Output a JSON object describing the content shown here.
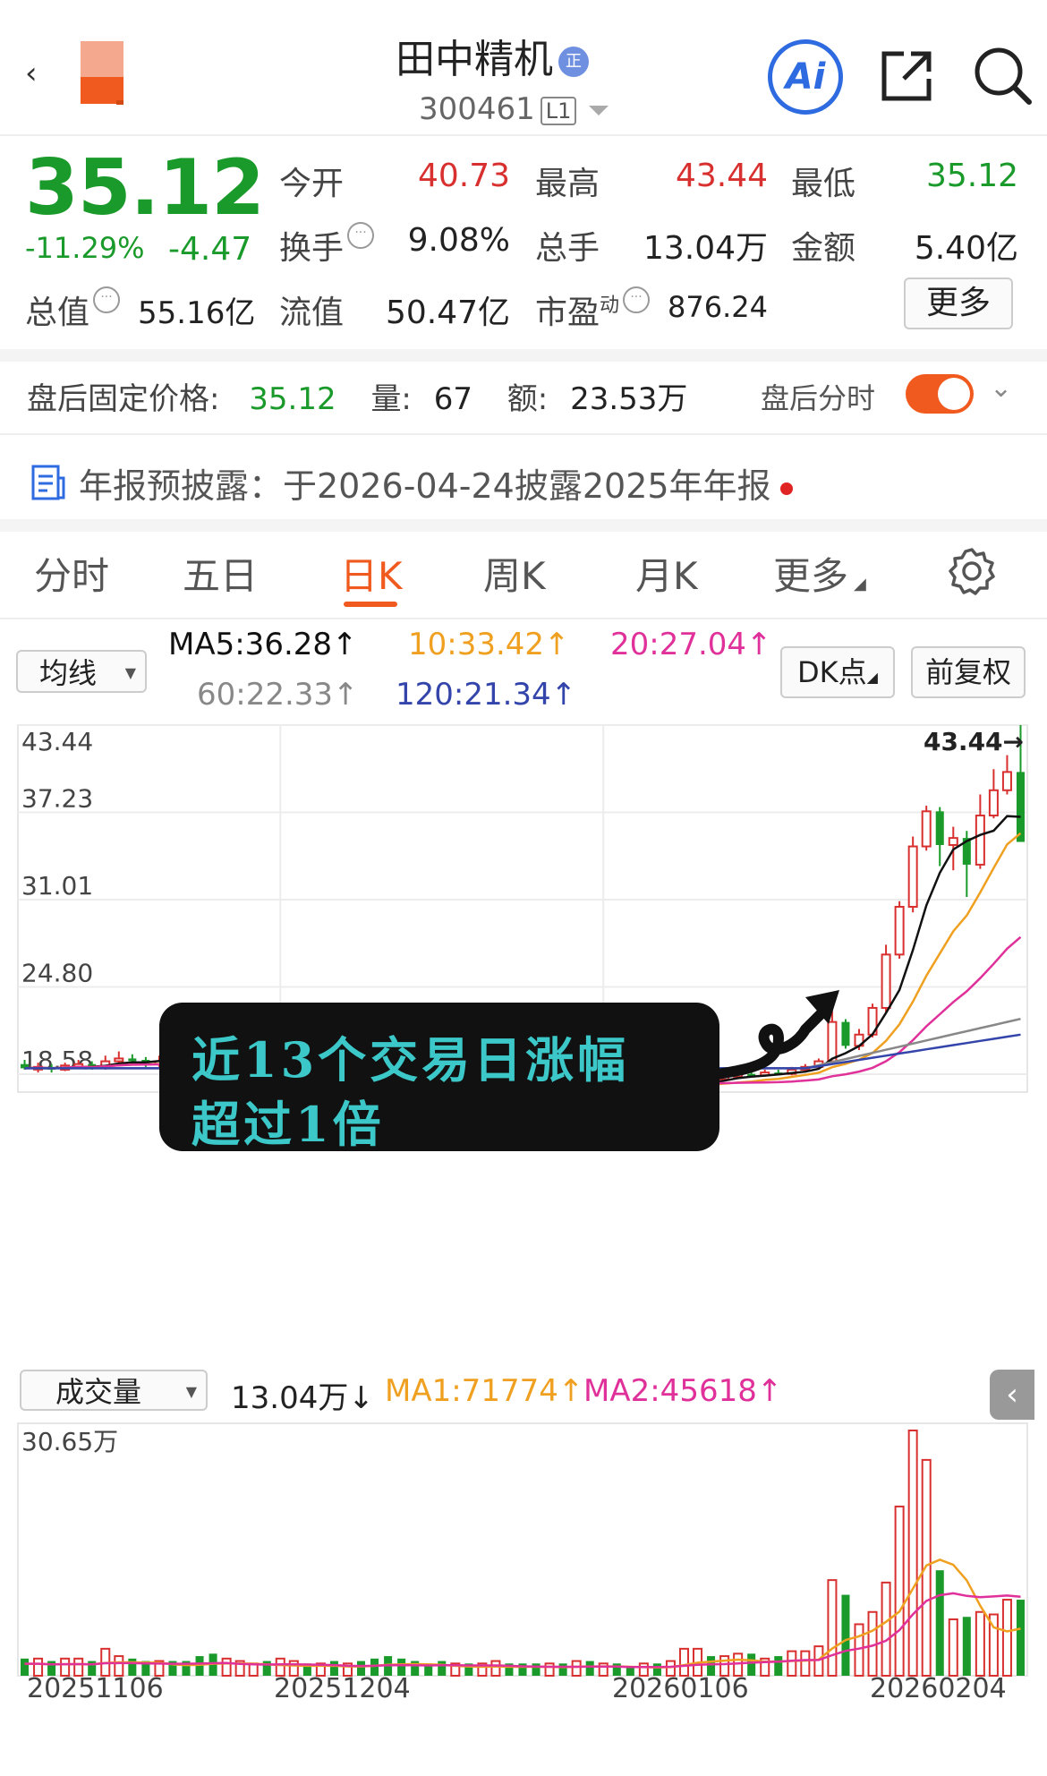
{
  "header": {
    "back": "‹",
    "name": "田中精机",
    "badge": "正",
    "code": "300461",
    "level": "L1",
    "ai_label": "Ai"
  },
  "quote": {
    "price": "35.12",
    "pct": "-11.29%",
    "change": "-4.47",
    "open_label": "今开",
    "open": "40.73",
    "high_label": "最高",
    "high": "43.44",
    "low_label": "最低",
    "low": "35.12",
    "turnover_label": "换手",
    "turnover": "9.08%",
    "volume_label": "总手",
    "volume": "13.04万",
    "amount_label": "金额",
    "amount": "5.40亿",
    "mktcap_label": "总值",
    "mktcap": "55.16亿",
    "float_label": "流值",
    "float": "50.47亿",
    "pe_label": "市盈",
    "pe_sup": "动",
    "pe": "876.24",
    "more": "更多"
  },
  "after_hours": {
    "label": "盘后固定价格:",
    "price": "35.12",
    "vol_label": "量:",
    "vol": "67",
    "amt_label": "额:",
    "amt": "23.53万",
    "toggle_label": "盘后分时"
  },
  "annual": {
    "text": "年报预披露：于2026-04-24披露2025年年报"
  },
  "tabs": [
    "分时",
    "五日",
    "日K",
    "周K",
    "月K",
    "更多"
  ],
  "ma": {
    "selector": "均线",
    "ma5": "MA5:36.28↑",
    "ma10": "10:33.42↑",
    "ma20": "20:27.04↑",
    "ma60": "60:22.33↑",
    "ma120": "120:21.34↑",
    "dk": "DK点",
    "adjust": "前复权"
  },
  "colors": {
    "up": "#d8302f",
    "down": "#1a9a2a",
    "accent": "#f05a1e",
    "ma5": "#111111",
    "ma10": "#f0a020",
    "ma20": "#e0309a",
    "ma60": "#888888",
    "ma120": "#3344aa"
  },
  "volume": {
    "selector": "成交量",
    "value": "13.04万↓",
    "ma1": "MA1:71774↑",
    "ma2": "MA2:45618↑",
    "max_label": "30.65万"
  },
  "annotation": {
    "line1": "近13个交易日涨幅",
    "line2": "超过1倍"
  },
  "chart_data": {
    "type": "candlestick",
    "y_ticks": [
      "43.44",
      "37.23",
      "31.01",
      "24.80",
      "18.58"
    ],
    "ylim": [
      18.58,
      43.44
    ],
    "high_marker": "43.44→",
    "low_marker": "18.58",
    "x_ticks": [
      "20251106",
      "20251204",
      "20260106",
      "20260204"
    ],
    "candles": [
      [
        19.3,
        19.0,
        19.6,
        18.9
      ],
      [
        19.0,
        19.1,
        19.4,
        18.7
      ],
      [
        19.1,
        18.9,
        19.3,
        18.7
      ],
      [
        18.9,
        19.2,
        19.4,
        18.8
      ],
      [
        19.2,
        19.3,
        19.6,
        19.0
      ],
      [
        19.3,
        19.0,
        19.5,
        18.9
      ],
      [
        19.0,
        19.5,
        19.9,
        18.9
      ],
      [
        19.5,
        19.7,
        20.2,
        19.3
      ],
      [
        19.7,
        19.6,
        20.0,
        19.3
      ],
      [
        19.6,
        19.3,
        19.8,
        19.1
      ],
      [
        19.3,
        19.5,
        19.9,
        19.1
      ],
      [
        19.5,
        19.4,
        19.7,
        19.1
      ],
      [
        19.4,
        19.1,
        19.6,
        18.9
      ],
      [
        19.1,
        18.8,
        19.3,
        18.6
      ],
      [
        18.8,
        18.3,
        19.0,
        18.1
      ],
      [
        18.3,
        18.7,
        18.9,
        18.2
      ],
      [
        18.7,
        18.9,
        19.2,
        18.5
      ],
      [
        18.9,
        19.1,
        19.3,
        18.7
      ],
      [
        19.1,
        19.0,
        19.4,
        18.8
      ],
      [
        19.0,
        19.3,
        19.5,
        18.8
      ],
      [
        19.3,
        19.4,
        19.7,
        19.1
      ],
      [
        19.4,
        19.2,
        19.6,
        19.0
      ],
      [
        19.2,
        19.5,
        19.8,
        19.0
      ],
      [
        19.5,
        19.4,
        19.8,
        19.2
      ],
      [
        19.4,
        19.7,
        20.0,
        19.2
      ],
      [
        19.7,
        19.6,
        19.9,
        19.4
      ],
      [
        19.6,
        19.3,
        19.8,
        19.1
      ],
      [
        19.3,
        19.0,
        19.5,
        18.8
      ],
      [
        19.0,
        18.8,
        19.2,
        18.6
      ],
      [
        18.8,
        18.5,
        19.0,
        18.3
      ],
      [
        18.5,
        18.3,
        18.7,
        18.0
      ],
      [
        18.3,
        17.9,
        18.5,
        17.8
      ],
      [
        17.9,
        18.3,
        18.5,
        17.8
      ],
      [
        18.3,
        18.1,
        18.4,
        17.9
      ],
      [
        18.1,
        18.2,
        18.4,
        17.9
      ],
      [
        18.2,
        18.4,
        18.6,
        18.0
      ],
      [
        18.4,
        18.2,
        18.6,
        18.0
      ],
      [
        18.2,
        18.0,
        18.4,
        17.8
      ],
      [
        18.0,
        17.8,
        18.2,
        17.7
      ],
      [
        17.8,
        17.9,
        18.1,
        17.7
      ],
      [
        17.9,
        17.7,
        18.0,
        17.6
      ],
      [
        17.7,
        17.8,
        18.0,
        17.6
      ],
      [
        17.8,
        17.6,
        17.9,
        17.5
      ],
      [
        17.6,
        17.9,
        18.0,
        17.5
      ],
      [
        17.9,
        17.7,
        18.1,
        17.6
      ],
      [
        17.7,
        17.6,
        17.9,
        17.5
      ],
      [
        17.6,
        17.8,
        18.0,
        17.5
      ],
      [
        17.8,
        17.5,
        17.9,
        17.4
      ],
      [
        17.5,
        17.7,
        17.9,
        17.4
      ],
      [
        17.7,
        18.0,
        18.2,
        17.6
      ],
      [
        18.0,
        18.3,
        18.5,
        17.9
      ],
      [
        18.3,
        18.2,
        18.5,
        18.0
      ],
      [
        18.2,
        18.4,
        18.6,
        18.1
      ],
      [
        18.4,
        18.6,
        18.9,
        18.3
      ],
      [
        18.6,
        18.5,
        18.8,
        18.4
      ],
      [
        18.5,
        18.7,
        18.9,
        18.4
      ],
      [
        18.7,
        18.6,
        18.9,
        18.5
      ],
      [
        18.6,
        18.9,
        19.1,
        18.5
      ],
      [
        18.9,
        19.1,
        19.3,
        18.7
      ],
      [
        19.1,
        19.5,
        19.7,
        19.0
      ],
      [
        19.5,
        22.3,
        23.1,
        19.4
      ],
      [
        22.3,
        20.6,
        22.5,
        20.4
      ],
      [
        20.6,
        21.4,
        21.8,
        20.3
      ],
      [
        21.4,
        23.3,
        23.6,
        21.2
      ],
      [
        23.3,
        27.1,
        27.8,
        22.9
      ],
      [
        27.1,
        30.5,
        30.9,
        26.8
      ],
      [
        30.5,
        34.8,
        35.5,
        30.1
      ],
      [
        34.8,
        37.3,
        37.7,
        34.5
      ],
      [
        37.3,
        34.9,
        37.6,
        33.4
      ],
      [
        34.9,
        35.4,
        36.2,
        33.1
      ],
      [
        35.4,
        33.5,
        35.9,
        31.2
      ],
      [
        33.5,
        37.0,
        38.5,
        33.2
      ],
      [
        37.0,
        38.8,
        40.3,
        36.8
      ],
      [
        38.8,
        40.1,
        41.3,
        38.5
      ],
      [
        40.1,
        35.12,
        43.44,
        35.12
      ]
    ],
    "volume_ratio": [
      0.07,
      0.07,
      0.06,
      0.07,
      0.07,
      0.06,
      0.11,
      0.08,
      0.07,
      0.06,
      0.06,
      0.06,
      0.06,
      0.08,
      0.09,
      0.07,
      0.06,
      0.05,
      0.06,
      0.07,
      0.06,
      0.05,
      0.05,
      0.06,
      0.05,
      0.06,
      0.07,
      0.08,
      0.07,
      0.06,
      0.05,
      0.06,
      0.05,
      0.05,
      0.05,
      0.06,
      0.05,
      0.05,
      0.05,
      0.05,
      0.05,
      0.06,
      0.06,
      0.05,
      0.05,
      0.04,
      0.05,
      0.05,
      0.06,
      0.11,
      0.11,
      0.08,
      0.08,
      0.09,
      0.09,
      0.07,
      0.08,
      0.1,
      0.1,
      0.12,
      0.39,
      0.33,
      0.21,
      0.26,
      0.38,
      0.69,
      1.0,
      0.88,
      0.43,
      0.23,
      0.24,
      0.26,
      0.25,
      0.31,
      0.31
    ],
    "series": [
      "MA5",
      "10",
      "20",
      "60",
      "120"
    ]
  }
}
